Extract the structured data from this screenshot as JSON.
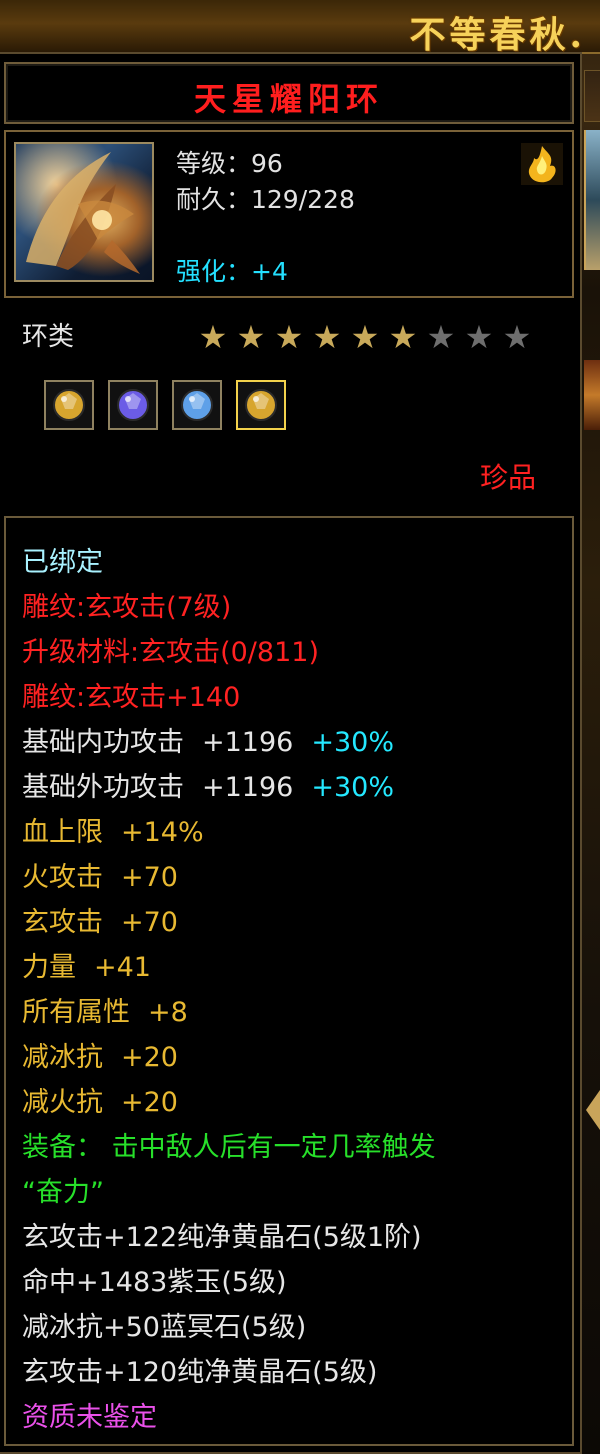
{
  "banner": {
    "text": "不等春秋."
  },
  "item": {
    "name": "天星耀阳环",
    "level_line": "等级：96",
    "durability_line": "耐久：129/228",
    "enhance_line": "强化：+4",
    "category": "环类",
    "stars": {
      "filled": 6,
      "total": 9
    },
    "gems": [
      {
        "icon": "yellow-crystal-gem-icon",
        "color": "#d7a52e",
        "selected": false
      },
      {
        "icon": "purple-jade-gem-icon",
        "color": "#6b5ce6",
        "selected": false
      },
      {
        "icon": "blue-stone-gem-icon",
        "color": "#5ea0e8",
        "selected": false
      },
      {
        "icon": "yellow-crystal-gem-icon",
        "color": "#d7a52e",
        "selected": true
      }
    ],
    "rarity": "珍品"
  },
  "properties": {
    "bound": "已绑定",
    "engrave_1": "雕纹:玄攻击(7级)",
    "upgrade_material": "升级材料:玄攻击(0/811)",
    "engrave_2": "雕纹:玄攻击+140",
    "base_inner": {
      "label": "基础内功攻击",
      "value": "+1196",
      "percent": "+30%"
    },
    "base_outer": {
      "label": "基础外功攻击",
      "value": "+1196",
      "percent": "+30%"
    },
    "hp": {
      "label": "血上限",
      "value": "+14%"
    },
    "fire_atk": {
      "label": "火攻击",
      "value": "+70"
    },
    "xuan_atk": {
      "label": "玄攻击",
      "value": "+70"
    },
    "strength": {
      "label": "力量",
      "value": "+41"
    },
    "all_attr": {
      "label": "所有属性",
      "value": "+8"
    },
    "ice_res": {
      "label": "减冰抗",
      "value": "+20"
    },
    "fire_res": {
      "label": "减火抗",
      "value": "+20"
    },
    "equip_effect_1": "装备： 击中敌人后有一定几率触发",
    "equip_effect_2": "“奋力”",
    "gem_1": "玄攻击+122纯净黄晶石(5级1阶)",
    "gem_2": "命中+1483紫玉(5级)",
    "gem_3": "减冰抗+50蓝冥石(5级)",
    "gem_4": "玄攻击+120纯净黄晶石(5级)",
    "quality": "资质未鉴定"
  },
  "colors": {
    "title": "#ff1e1e",
    "star_filled": "#c8a95a",
    "star_empty": "#6e6e6e"
  }
}
